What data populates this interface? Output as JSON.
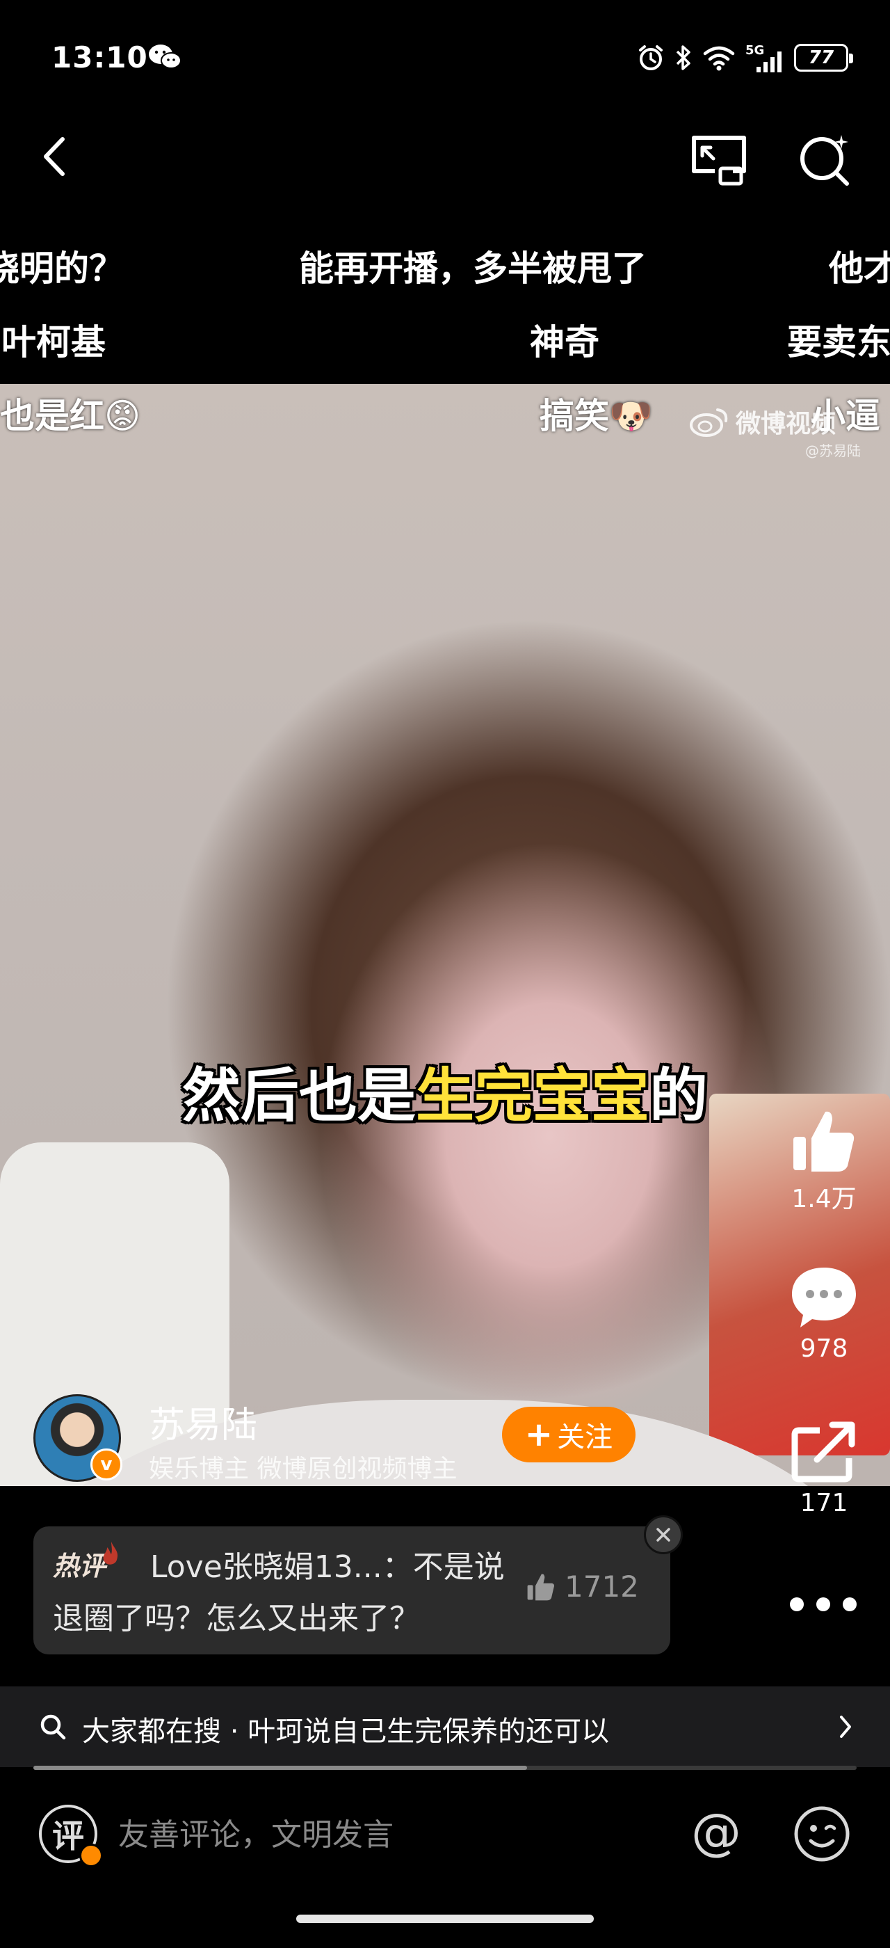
{
  "status_bar": {
    "time": "13:10",
    "network": "5G",
    "battery": "77"
  },
  "danmaku": [
    {
      "text": "晓明的？"
    },
    {
      "text": "能再开播，多半被甩了"
    },
    {
      "text": "他才"
    },
    {
      "text": "叶柯基"
    },
    {
      "text": "神奇"
    },
    {
      "text": "要卖东"
    },
    {
      "text": "也是红😡"
    },
    {
      "text": "搞笑🐶"
    },
    {
      "text": "小逼"
    }
  ],
  "video": {
    "watermark": "微博视频",
    "watermark_sub": "@苏易陆",
    "subtitle_white_a": "然后也是",
    "subtitle_yellow": "生完宝宝",
    "subtitle_white_b": "的"
  },
  "actions": {
    "like_count": "1.4万",
    "comment_count": "978",
    "share_count": "171"
  },
  "author": {
    "name": "苏易陆",
    "tags": "娱乐博主 微博原创视频博主",
    "verify": "v",
    "follow_label": "关注",
    "follow_plus": "+"
  },
  "hot_comment": {
    "badge": "热评",
    "text": "Love张晓娟13...：不是说退圈了吗？怎么又出来了？",
    "likes": "1712"
  },
  "search_bar": {
    "text": "大家都在搜 · 叶珂说自己生完保养的还可以",
    "progress": 0.6
  },
  "comment_box": {
    "icon_label": "评",
    "placeholder": "友善评论，文明发言",
    "at_label": "@"
  },
  "colors": {
    "accent_orange": "#ff8200",
    "subtitle_yellow": "#ffe23a"
  }
}
